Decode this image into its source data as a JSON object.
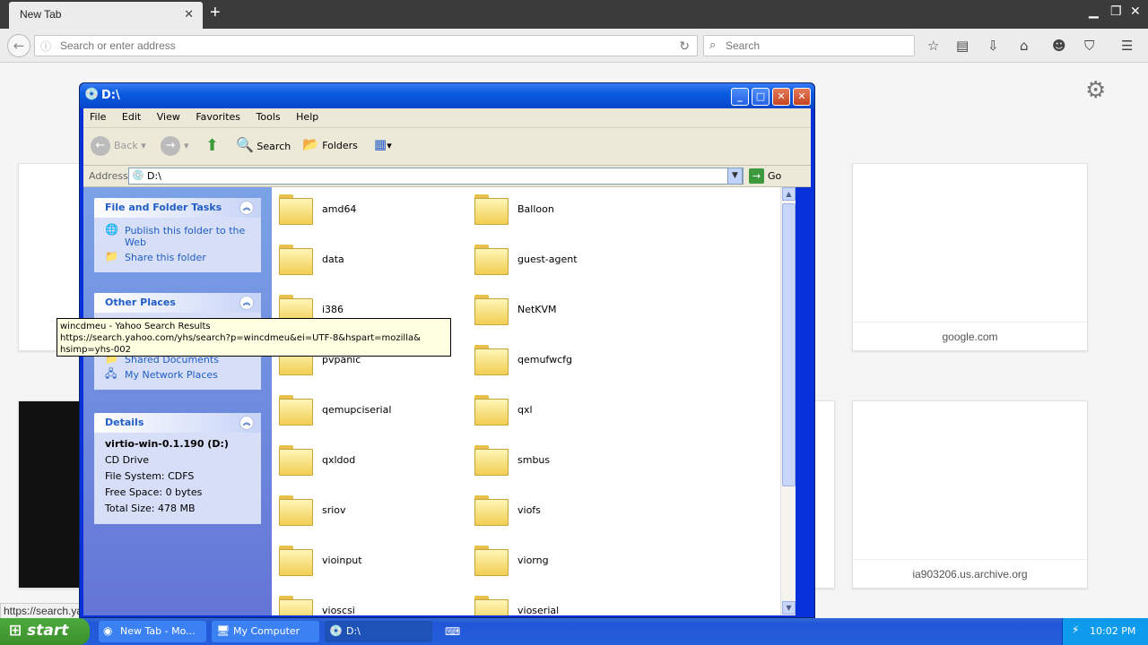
{
  "browser": {
    "tab_title": "New Tab",
    "tab_close": "✕",
    "new_tab": "+",
    "url_placeholder": "Search or enter address",
    "search_placeholder": "Search",
    "tiles": [
      {
        "label": ""
      },
      {
        "label": "google.com"
      },
      {
        "label": ""
      },
      {
        "label": "ia903206.us.archive.org"
      }
    ],
    "status_text": "https://search.ya"
  },
  "explorer": {
    "title": "D:\\",
    "menu": [
      "File",
      "Edit",
      "View",
      "Favorites",
      "Tools",
      "Help"
    ],
    "toolbar": {
      "back": "Back",
      "search": "Search",
      "folders": "Folders"
    },
    "address_label": "Address",
    "address_value": "D:\\",
    "go_label": "Go",
    "tasks_panel": {
      "title": "File and Folder Tasks",
      "items": [
        "Publish this folder to the Web",
        "Share this folder"
      ]
    },
    "other_places": {
      "title": "Other Places",
      "items": [
        "Shared Documents",
        "My Network Places"
      ]
    },
    "details": {
      "title": "Details",
      "name": "virtio-win-0.1.190 (D:)",
      "type": "CD Drive",
      "filesystem": "File System: CDFS",
      "free": "Free Space: 0 bytes",
      "total": "Total Size: 478 MB"
    },
    "folders": [
      "amd64",
      "Balloon",
      "data",
      "guest-agent",
      "i386",
      "NetKVM",
      "pvpanic",
      "qemufwcfg",
      "qemupciserial",
      "qxl",
      "qxldod",
      "smbus",
      "sriov",
      "viofs",
      "vioinput",
      "viorng",
      "vioscsi",
      "vioserial"
    ]
  },
  "tooltip": {
    "line1": "wincdmeu - Yahoo Search Results",
    "line2": "https://search.yahoo.com/yhs/search?p=wincdmeu&ei=UTF-8&hspart=mozilla&",
    "line3": "hsimp=yhs-002"
  },
  "taskbar": {
    "start": "start",
    "buttons": [
      "New Tab - Mo...",
      "My Computer",
      "D:\\"
    ],
    "clock": "10:02 PM"
  }
}
